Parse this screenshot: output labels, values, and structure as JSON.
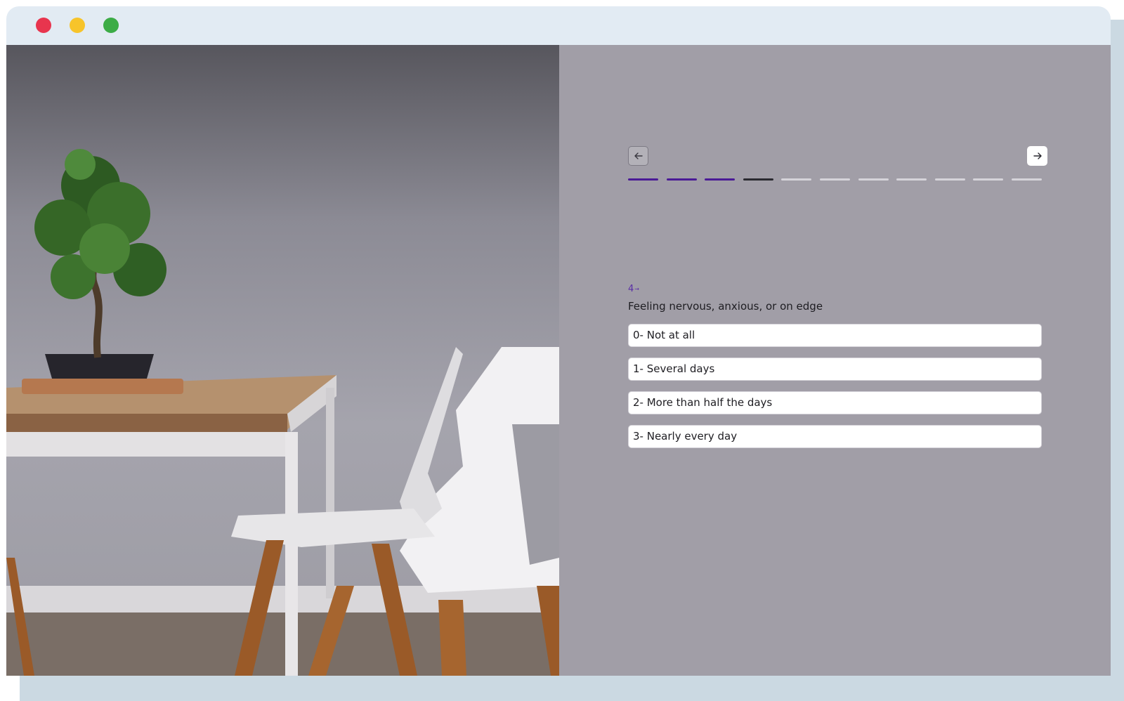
{
  "window": {
    "controls": [
      "close-dot",
      "minimize-dot",
      "maximize-dot"
    ],
    "colors": {
      "close": "#e8354e",
      "minimize": "#f7c42a",
      "maximize": "#3cac46"
    }
  },
  "survey": {
    "progress": {
      "total_steps": 11,
      "completed_steps": 3,
      "current_step": 4
    },
    "colors": {
      "completed": "#4a1a96",
      "current": "#2a2a30",
      "upcoming": "#d6d4da"
    },
    "question": {
      "number": "4",
      "number_marker": "→",
      "text": "Feeling nervous, anxious, or on edge"
    },
    "options": [
      {
        "label": "0- Not at all"
      },
      {
        "label": "1- Several days"
      },
      {
        "label": "2- More than half the days"
      },
      {
        "label": "3- Nearly every day"
      }
    ],
    "nav": {
      "prev_icon": "arrow-left-icon",
      "next_icon": "arrow-right-icon"
    }
  }
}
